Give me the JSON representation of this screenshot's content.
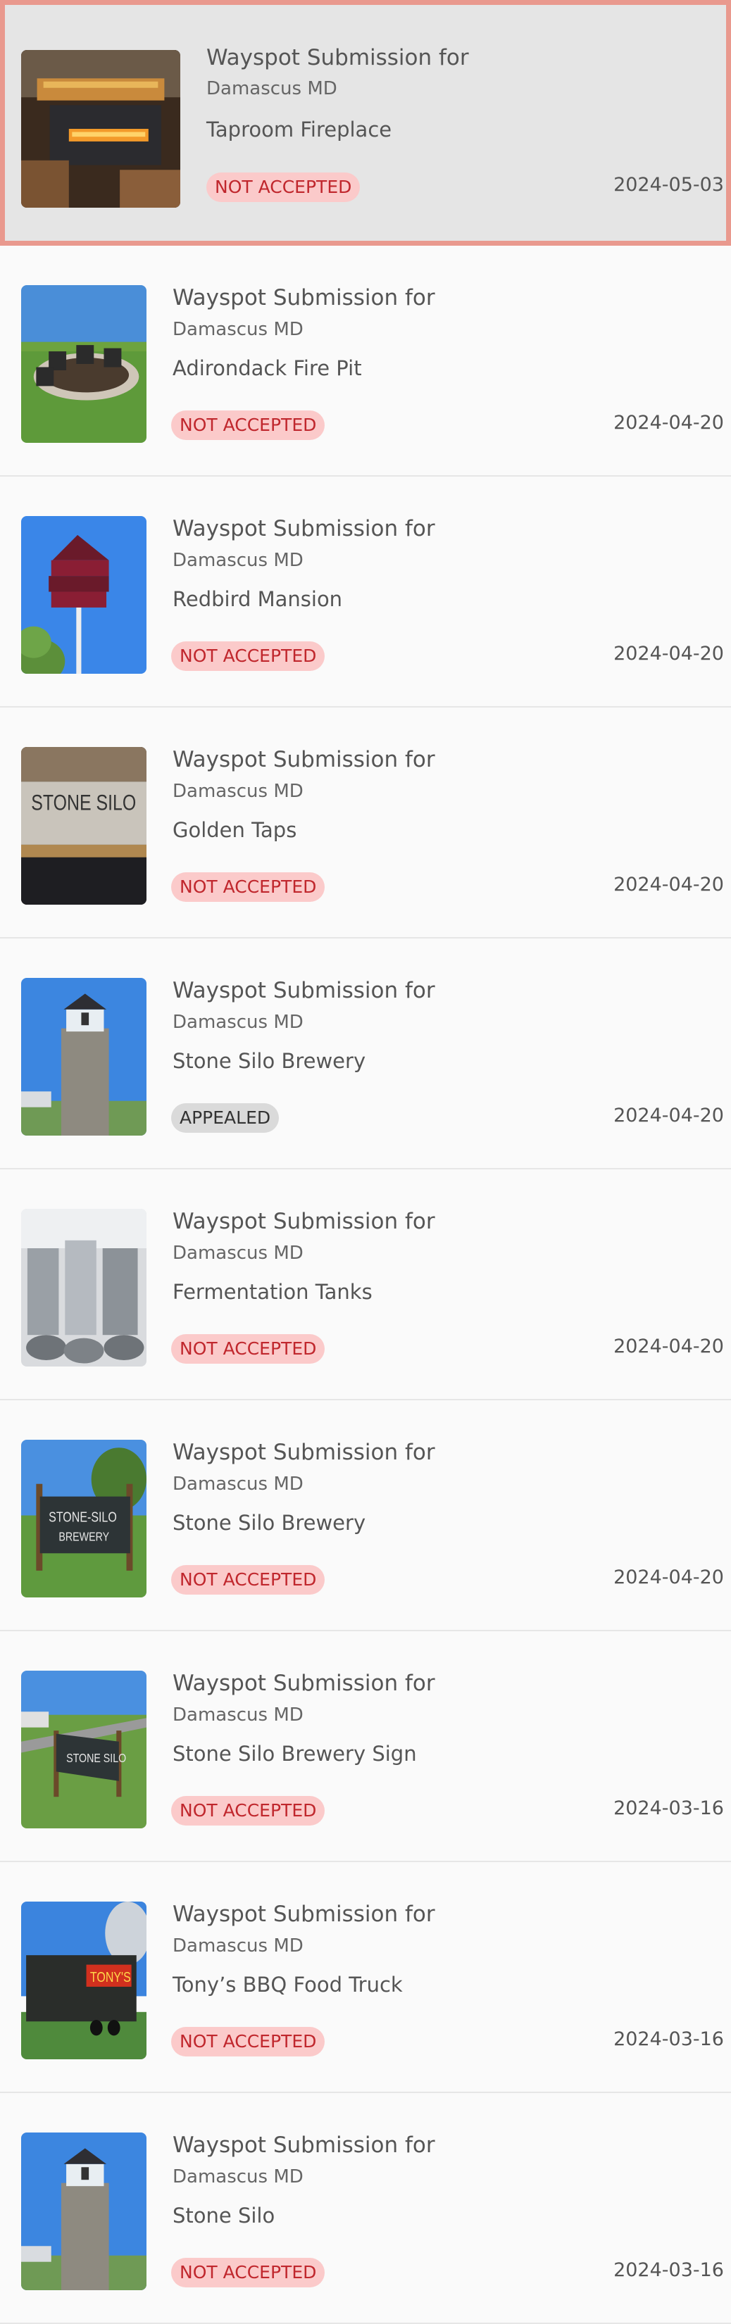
{
  "submissions": [
    {
      "title": "Wayspot Submission for",
      "location": "Damascus MD",
      "name": "Taproom Fireplace",
      "status": "NOT ACCEPTED",
      "status_type": "rejected",
      "date": "2024-05-03",
      "selected": true,
      "thumb": "fireplace"
    },
    {
      "title": "Wayspot Submission for",
      "location": "Damascus MD",
      "name": "Adirondack Fire Pit",
      "status": "NOT ACCEPTED",
      "status_type": "rejected",
      "date": "2024-04-20",
      "selected": false,
      "thumb": "firepit"
    },
    {
      "title": "Wayspot Submission for",
      "location": "Damascus MD",
      "name": "Redbird Mansion",
      "status": "NOT ACCEPTED",
      "status_type": "rejected",
      "date": "2024-04-20",
      "selected": false,
      "thumb": "birdhouse"
    },
    {
      "title": "Wayspot Submission for",
      "location": "Damascus MD",
      "name": "Golden Taps",
      "status": "NOT ACCEPTED",
      "status_type": "rejected",
      "date": "2024-04-20",
      "selected": false,
      "thumb": "bar"
    },
    {
      "title": "Wayspot Submission for",
      "location": "Damascus MD",
      "name": "Stone Silo Brewery",
      "status": "APPEALED",
      "status_type": "appealed",
      "date": "2024-04-20",
      "selected": false,
      "thumb": "silo"
    },
    {
      "title": "Wayspot Submission for",
      "location": "Damascus MD",
      "name": "Fermentation Tanks",
      "status": "NOT ACCEPTED",
      "status_type": "rejected",
      "date": "2024-04-20",
      "selected": false,
      "thumb": "tanks"
    },
    {
      "title": "Wayspot Submission for",
      "location": "Damascus MD",
      "name": "Stone Silo Brewery",
      "status": "NOT ACCEPTED",
      "status_type": "rejected",
      "date": "2024-04-20",
      "selected": false,
      "thumb": "sign"
    },
    {
      "title": "Wayspot Submission for",
      "location": "Damascus MD",
      "name": "Stone Silo Brewery Sign",
      "status": "NOT ACCEPTED",
      "status_type": "rejected",
      "date": "2024-03-16",
      "selected": false,
      "thumb": "sign2"
    },
    {
      "title": "Wayspot Submission for",
      "location": "Damascus MD",
      "name": "Tony’s BBQ Food Truck",
      "status": "NOT ACCEPTED",
      "status_type": "rejected",
      "date": "2024-03-16",
      "selected": false,
      "thumb": "truck"
    },
    {
      "title": "Wayspot Submission for",
      "location": "Damascus MD",
      "name": "Stone Silo",
      "status": "NOT ACCEPTED",
      "status_type": "rejected",
      "date": "2024-03-16",
      "selected": false,
      "thumb": "silo"
    }
  ]
}
